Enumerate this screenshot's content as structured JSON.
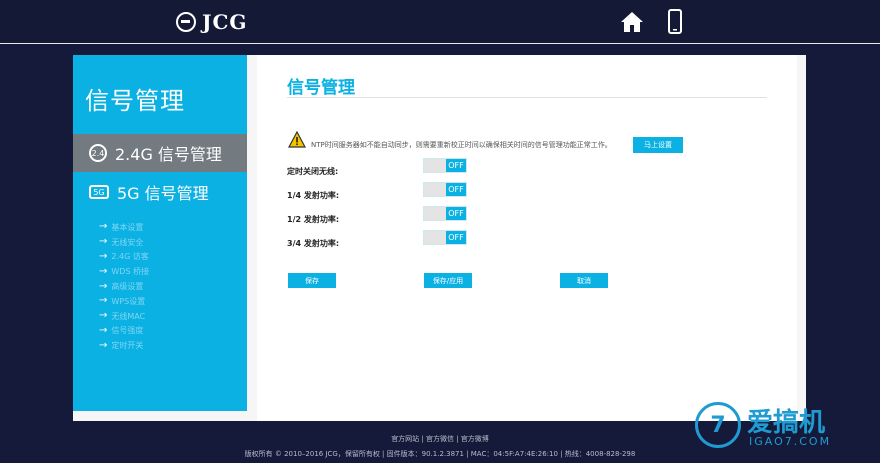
{
  "header": {
    "logo_text": "JCG",
    "home_icon": "home-icon",
    "mobile_icon": "mobile-phone-icon"
  },
  "sidebar": {
    "title": "信号管理",
    "items": [
      {
        "label": "2.4G 信号管理",
        "icon": "24g-icon",
        "active": true
      },
      {
        "label": "5G 信号管理",
        "icon": "5g-icon",
        "active": false
      }
    ],
    "sub_items": [
      "基本设置",
      "无线安全",
      "2.4G 访客",
      "WDS 桥接",
      "高级设置",
      "WPS设置",
      "无线MAC",
      "信号强度",
      "定时开关"
    ]
  },
  "main": {
    "title": "信号管理",
    "notice": "NTP时间服务器如不能自动同步，则需要重新校正时间以确保相关时间的信号管理功能正常工作。",
    "notice_button": "马上设置",
    "rows": [
      {
        "label": "定时关闭无线:",
        "state": "OFF"
      },
      {
        "label": "1/4 发射功率:",
        "state": "OFF"
      },
      {
        "label": "1/2 发射功率:",
        "state": "OFF"
      },
      {
        "label": "3/4 发射功率:",
        "state": "OFF"
      }
    ],
    "buttons": {
      "save": "保存",
      "save_apply": "保存/应用",
      "cancel": "取消"
    }
  },
  "footer": {
    "links": [
      "官方网站",
      "官方微信",
      "官方微博"
    ],
    "separator": " | ",
    "copyright": "版权所有 © 2010–2016 JCG，保留所有权 | 固件版本：90.1.2.3871 | MAC：04:5F:A7:4E:26:10 | 热线：4008-828-298"
  },
  "watermark": {
    "mark": "7",
    "text": "爱搞机",
    "sub": "IGAO7.COM"
  },
  "colors": {
    "accent": "#0cb1e4",
    "background": "#151a3a",
    "active_item": "#737a80"
  }
}
